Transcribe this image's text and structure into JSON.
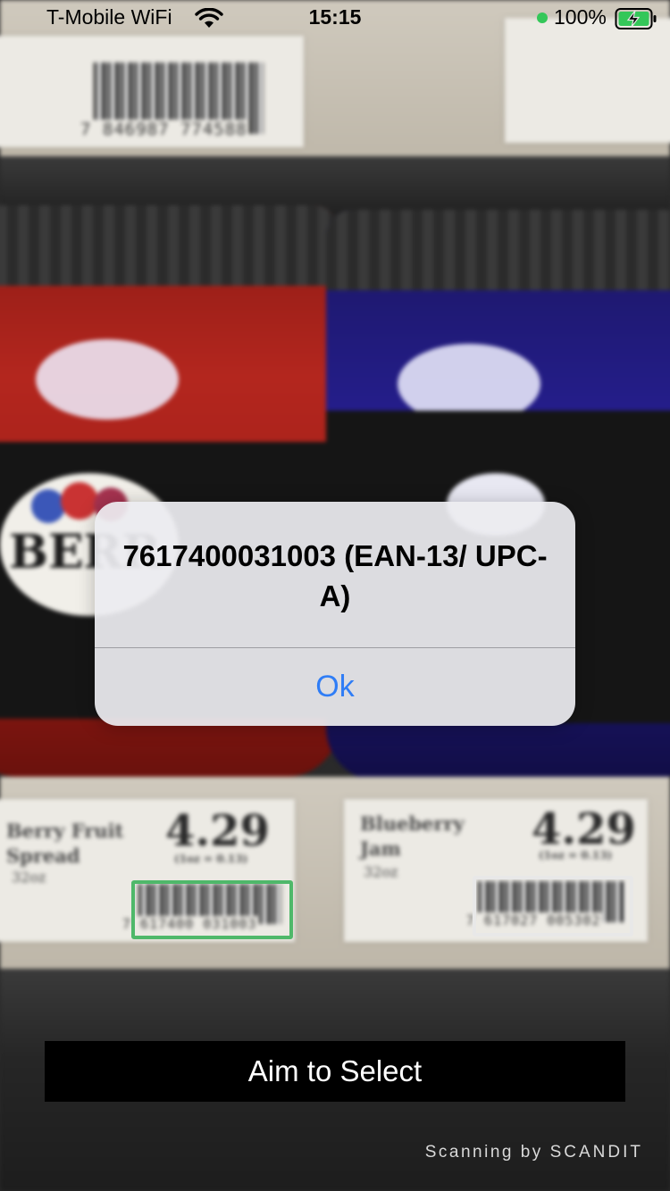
{
  "status_bar": {
    "carrier": "T-Mobile WiFi",
    "time": "15:15",
    "battery_percent": "100%",
    "battery_icon": "battery-charging-icon",
    "wifi_icon": "wifi-icon"
  },
  "camera_scene": {
    "top_left_barcode_digits": "7 846987 774588",
    "left_price_label": {
      "name": "Berry Fruit Spread",
      "size": "32oz",
      "price": "4.29",
      "unit_price": "(1oz = 0.13)",
      "barcode_digits": "7 617400 031003"
    },
    "right_price_label": {
      "name": "Blueberry Jam",
      "size": "32oz",
      "price": "4.29",
      "unit_price": "(1oz = 0.13)",
      "barcode_digits": "7 617027 005302"
    },
    "scan_colors": {
      "selected": "#4fb86a",
      "candidate": "#e8e8e8"
    }
  },
  "alert": {
    "message": "7617400031003 (EAN-13/ UPC-A)",
    "ok_label": "Ok"
  },
  "aim_button_label": "Aim to Select",
  "branding": {
    "prefix": "Scanning by",
    "brand": "SCANDIT"
  }
}
